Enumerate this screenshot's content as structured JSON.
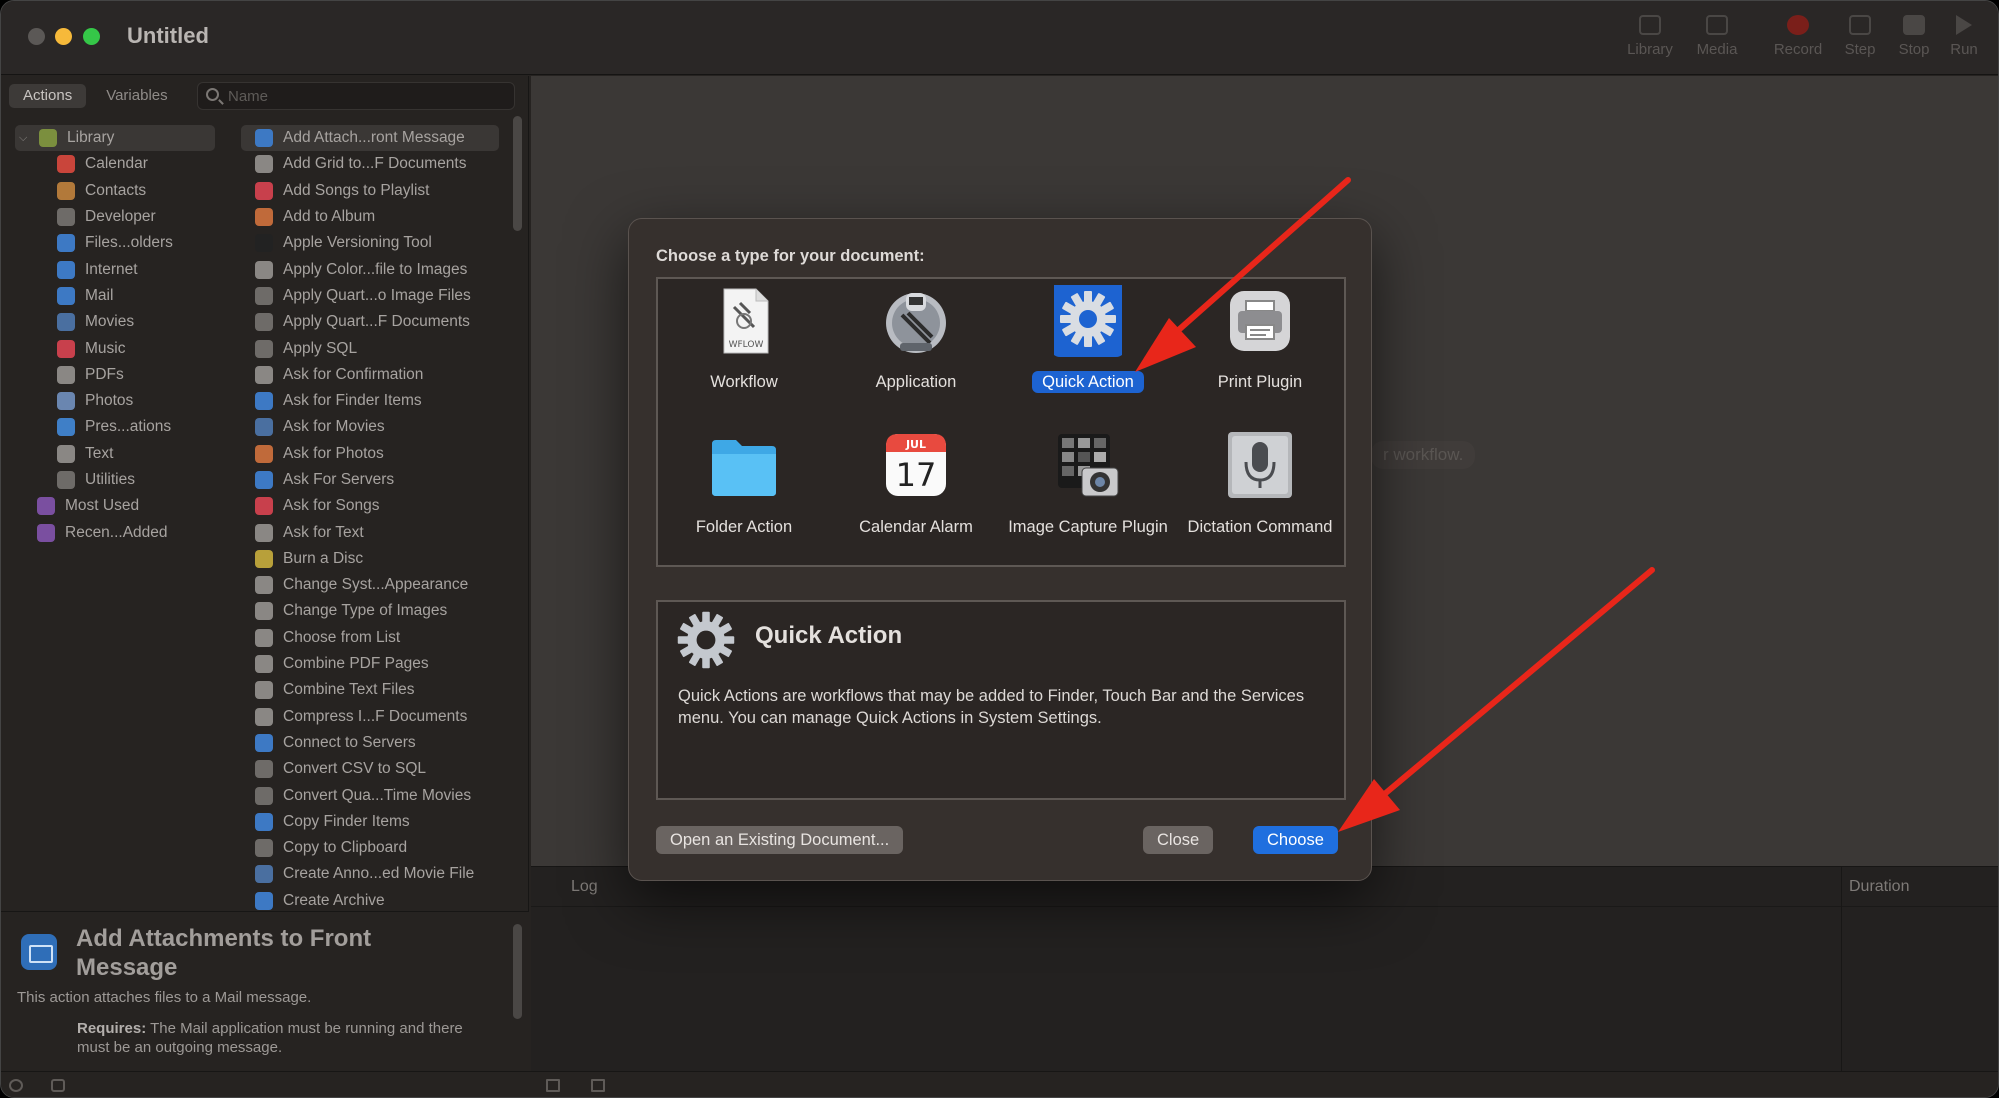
{
  "window": {
    "title": "Untitled",
    "toolbar": [
      {
        "label": "Library",
        "icon": "library-icon"
      },
      {
        "label": "Media",
        "icon": "media-icon"
      },
      {
        "label": "Record",
        "icon": "record-icon"
      },
      {
        "label": "Step",
        "icon": "step-icon"
      },
      {
        "label": "Stop",
        "icon": "stop-icon"
      },
      {
        "label": "Run",
        "icon": "run-icon"
      }
    ]
  },
  "leftpane": {
    "tabs": [
      "Actions",
      "Variables"
    ],
    "search_placeholder": "Name",
    "library": [
      {
        "label": "Library",
        "color": "#7b8f3e"
      },
      {
        "label": "Calendar",
        "color": "#c9453b"
      },
      {
        "label": "Contacts",
        "color": "#b2793a"
      },
      {
        "label": "Developer",
        "color": "#6e6b68"
      },
      {
        "label": "Files...olders",
        "color": "#3d79c4"
      },
      {
        "label": "Internet",
        "color": "#3d79c4"
      },
      {
        "label": "Mail",
        "color": "#3d79c4"
      },
      {
        "label": "Movies",
        "color": "#4a6fa0"
      },
      {
        "label": "Music",
        "color": "#c8404c"
      },
      {
        "label": "PDFs",
        "color": "#8a8784"
      },
      {
        "label": "Photos",
        "color": "#6a86b0"
      },
      {
        "label": "Pres...ations",
        "color": "#3f7fc7"
      },
      {
        "label": "Text",
        "color": "#8a8784"
      },
      {
        "label": "Utilities",
        "color": "#6e6b68"
      },
      {
        "label": "Most Used",
        "color": "#7a4fa0"
      },
      {
        "label": "Recen...Added",
        "color": "#7a4fa0"
      }
    ],
    "actions": [
      {
        "label": "Add Attach...ront Message",
        "color": "#3d79c4"
      },
      {
        "label": "Add Grid to...F Documents",
        "color": "#8a8784"
      },
      {
        "label": "Add Songs to Playlist",
        "color": "#c8404c"
      },
      {
        "label": "Add to Album",
        "color": "#c06a3a"
      },
      {
        "label": "Apple Versioning Tool",
        "color": "#222"
      },
      {
        "label": "Apply Color...file to Images",
        "color": "#8a8784"
      },
      {
        "label": "Apply Quart...o Image Files",
        "color": "#6e6b68"
      },
      {
        "label": "Apply Quart...F Documents",
        "color": "#6e6b68"
      },
      {
        "label": "Apply SQL",
        "color": "#6e6b68"
      },
      {
        "label": "Ask for Confirmation",
        "color": "#8a8784"
      },
      {
        "label": "Ask for Finder Items",
        "color": "#3d79c4"
      },
      {
        "label": "Ask for Movies",
        "color": "#4a6fa0"
      },
      {
        "label": "Ask for Photos",
        "color": "#c06a3a"
      },
      {
        "label": "Ask For Servers",
        "color": "#3d79c4"
      },
      {
        "label": "Ask for Songs",
        "color": "#c8404c"
      },
      {
        "label": "Ask for Text",
        "color": "#8a8784"
      },
      {
        "label": "Burn a Disc",
        "color": "#b8a03a"
      },
      {
        "label": "Change Syst...Appearance",
        "color": "#8a8784"
      },
      {
        "label": "Change Type of Images",
        "color": "#8a8784"
      },
      {
        "label": "Choose from List",
        "color": "#8a8784"
      },
      {
        "label": "Combine PDF Pages",
        "color": "#8a8784"
      },
      {
        "label": "Combine Text Files",
        "color": "#8a8784"
      },
      {
        "label": "Compress I...F Documents",
        "color": "#8a8784"
      },
      {
        "label": "Connect to Servers",
        "color": "#3d79c4"
      },
      {
        "label": "Convert CSV to SQL",
        "color": "#6e6b68"
      },
      {
        "label": "Convert Qua...Time Movies",
        "color": "#6e6b68"
      },
      {
        "label": "Copy Finder Items",
        "color": "#3d79c4"
      },
      {
        "label": "Copy to Clipboard",
        "color": "#6e6b68"
      },
      {
        "label": "Create Anno...ed Movie File",
        "color": "#4a6fa0"
      },
      {
        "label": "Create Archive",
        "color": "#3d79c4"
      }
    ],
    "description": {
      "title": "Add Attachments to Front Message",
      "text": "This action attaches files to a Mail message.",
      "requires_label": "Requires:",
      "requires_text": "The Mail application must be running and there must be an outgoing message."
    }
  },
  "canvas": {
    "hint": "r workflow."
  },
  "log": {
    "col_log": "Log",
    "col_duration": "Duration"
  },
  "dialog": {
    "prompt": "Choose a type for your document:",
    "types": [
      {
        "label": "Workflow",
        "icon": "workflow-document-icon"
      },
      {
        "label": "Application",
        "icon": "automator-robot-icon"
      },
      {
        "label": "Quick Action",
        "icon": "gear-icon",
        "selected": true
      },
      {
        "label": "Print Plugin",
        "icon": "printer-icon"
      },
      {
        "label": "Folder Action",
        "icon": "folder-icon"
      },
      {
        "label": "Calendar Alarm",
        "icon": "calendar-icon",
        "month": "JUL",
        "day": "17"
      },
      {
        "label": "Image Capture Plugin",
        "icon": "camera-icon"
      },
      {
        "label": "Dictation Command",
        "icon": "microphone-icon"
      }
    ],
    "selected_title": "Quick Action",
    "selected_description": "Quick Actions are workflows that may be added to Finder, Touch Bar and the Services menu. You can manage Quick Actions in System Settings.",
    "buttons": {
      "open_existing": "Open an Existing Document...",
      "close": "Close",
      "choose": "Choose"
    }
  },
  "colors": {
    "accent": "#1f6fdf",
    "arrow": "#e8261a"
  }
}
